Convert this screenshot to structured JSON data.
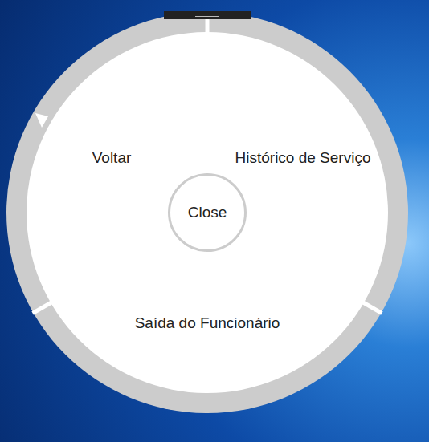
{
  "menu": {
    "center": {
      "label": "Close"
    },
    "items": [
      {
        "label": "Voltar"
      },
      {
        "label": "Histórico de Serviço"
      },
      {
        "label": "Saída do Funcionário"
      }
    ]
  }
}
